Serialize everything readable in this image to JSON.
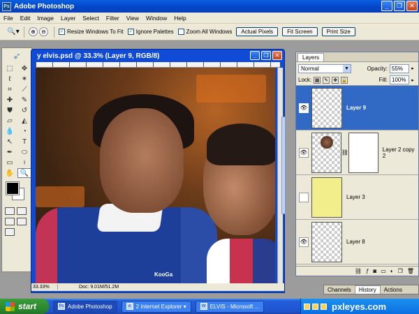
{
  "app": {
    "title": "Adobe Photoshop",
    "logo": "ps-logo-icon"
  },
  "window_buttons": [
    "_",
    "❐",
    "✕"
  ],
  "menu": [
    "File",
    "Edit",
    "Image",
    "Layer",
    "Select",
    "Filter",
    "View",
    "Window",
    "Help"
  ],
  "options": {
    "tool_icon": "zoom-tool-icon",
    "zoom_in": "⊕",
    "zoom_out": "⊖",
    "resize_windows": "Resize Windows To Fit",
    "ignore_palettes": "Ignore Palettes",
    "zoom_all": "Zoom All Windows",
    "actual_pixels": "Actual Pixels",
    "fit_screen": "Fit Screen",
    "print_size": "Print Size"
  },
  "document": {
    "title": "y elvis.psd @ 33.3% (Layer 9, RGB/8)",
    "zoom": "33.33%",
    "doc_size": "Doc: 9.01M/51.2M",
    "shirt_text": "KooGa"
  },
  "layers_panel": {
    "tab": "Layers",
    "blend_mode": "Normal",
    "opacity_label": "Opacity:",
    "opacity_value": "55%",
    "lock_label": "Lock:",
    "fill_label": "Fill:",
    "fill_value": "100%",
    "layers": [
      {
        "name": "Layer 9",
        "visible": true,
        "active": true
      },
      {
        "name": "Layer 2 copy 2",
        "visible": true,
        "active": false
      },
      {
        "name": "Layer 3",
        "visible": false,
        "active": false
      },
      {
        "name": "Layer 8",
        "visible": true,
        "active": false
      }
    ]
  },
  "bottom_tabs": [
    "Channels",
    "History",
    "Actions"
  ],
  "taskbar": {
    "start": "start",
    "items": [
      "Adobe Photoshop",
      "2 Internet Explorer",
      "ELVIS - Microsoft ..."
    ],
    "brand": "pxleyes.com"
  }
}
